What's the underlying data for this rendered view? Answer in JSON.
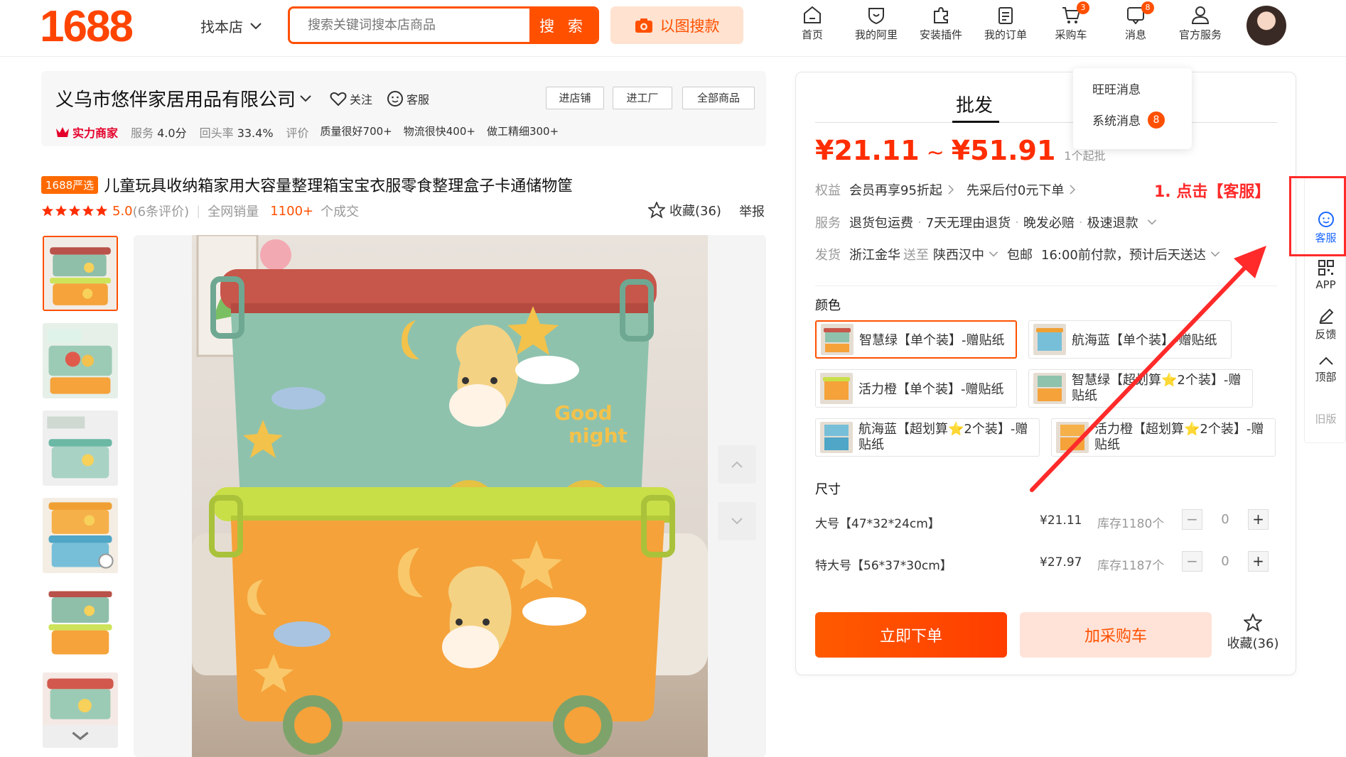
{
  "logo": "1688",
  "header": {
    "find_shop": "找本店",
    "search_placeholder": "搜索关键词搜本店商品",
    "search_button": "搜 索",
    "image_search": "以图搜款",
    "nav": [
      {
        "label": "首页",
        "icon": "home-icon"
      },
      {
        "label": "我的阿里",
        "icon": "shield-heart-icon"
      },
      {
        "label": "安装插件",
        "icon": "puzzle-icon"
      },
      {
        "label": "我的订单",
        "icon": "order-icon"
      },
      {
        "label": "采购车",
        "icon": "cart-icon",
        "badge": "3"
      },
      {
        "label": "消息",
        "icon": "message-icon",
        "badge": "8"
      },
      {
        "label": "官方服务",
        "icon": "user-icon"
      }
    ]
  },
  "messages_popup": {
    "wangwang": "旺旺消息",
    "system": "系统消息",
    "system_badge": "8"
  },
  "shop": {
    "name": "义乌市悠伴家居用品有限公司",
    "follow": "关注",
    "service": "客服",
    "buttons": [
      "进店铺",
      "进工厂",
      "全部商品"
    ],
    "badge": "实力商家",
    "service_score_label": "服务",
    "service_score": "4.0分",
    "repurchase_label": "回头率",
    "repurchase": "33.4%",
    "review_label": "评价",
    "reviews": [
      "质量很好700+",
      "物流很快400+",
      "做工精细300+"
    ]
  },
  "product": {
    "tag": "1688严选",
    "title": "儿童玩具收纳箱家用大容量整理箱宝宝衣服零食整理盒子卡通储物筐",
    "rating": "5.0",
    "rating_count": "(6条评价)",
    "sales_label": "全网销量",
    "sales": "1100+",
    "sales_suffix": "个成交",
    "favorite": "收藏(36)",
    "report": "举报"
  },
  "purchase": {
    "tab": "批发",
    "price_low": "¥21.11",
    "price_high": "¥51.91",
    "min_order": "1个起批",
    "benefits_label": "权益",
    "benefit_1": "会员再享95折起",
    "benefit_2": "先采后付0元下单",
    "service_label": "服务",
    "services": [
      "退货包运费",
      "7天无理由退货",
      "晚发必赔",
      "极速退款"
    ],
    "shipping_label": "发货",
    "ship_from": "浙江金华",
    "ship_to_label": "送至",
    "ship_to": "陕西汉中",
    "free_shipping": "包邮",
    "delivery": "16:00前付款，预计后天送达",
    "color_label": "颜色",
    "colors": [
      "智慧绿【单个装】-赠贴纸",
      "航海蓝【单个装】-赠贴纸",
      "活力橙【单个装】-赠贴纸",
      "智慧绿【超划算⭐2个装】-赠贴纸",
      "航海蓝【超划算⭐2个装】-赠贴纸",
      "活力橙【超划算⭐2个装】-赠贴纸"
    ],
    "size_label": "尺寸",
    "sizes": [
      {
        "name": "大号【47*32*24cm】",
        "price": "¥21.11",
        "stock": "库存1180个",
        "qty": "0"
      },
      {
        "name": "特大号【56*37*30cm】",
        "price": "¥27.97",
        "stock": "库存1187个",
        "qty": "0"
      }
    ],
    "buy_now": "立即下单",
    "add_cart": "加采购车",
    "favorite": "收藏(36)"
  },
  "annotation": "1. 点击【客服】",
  "rail": [
    "客服",
    "APP",
    "反馈",
    "顶部",
    "旧版"
  ],
  "colors": {
    "brand": "#ff5000",
    "price": "#ff2d00",
    "annotation": "#ff2a2a"
  }
}
